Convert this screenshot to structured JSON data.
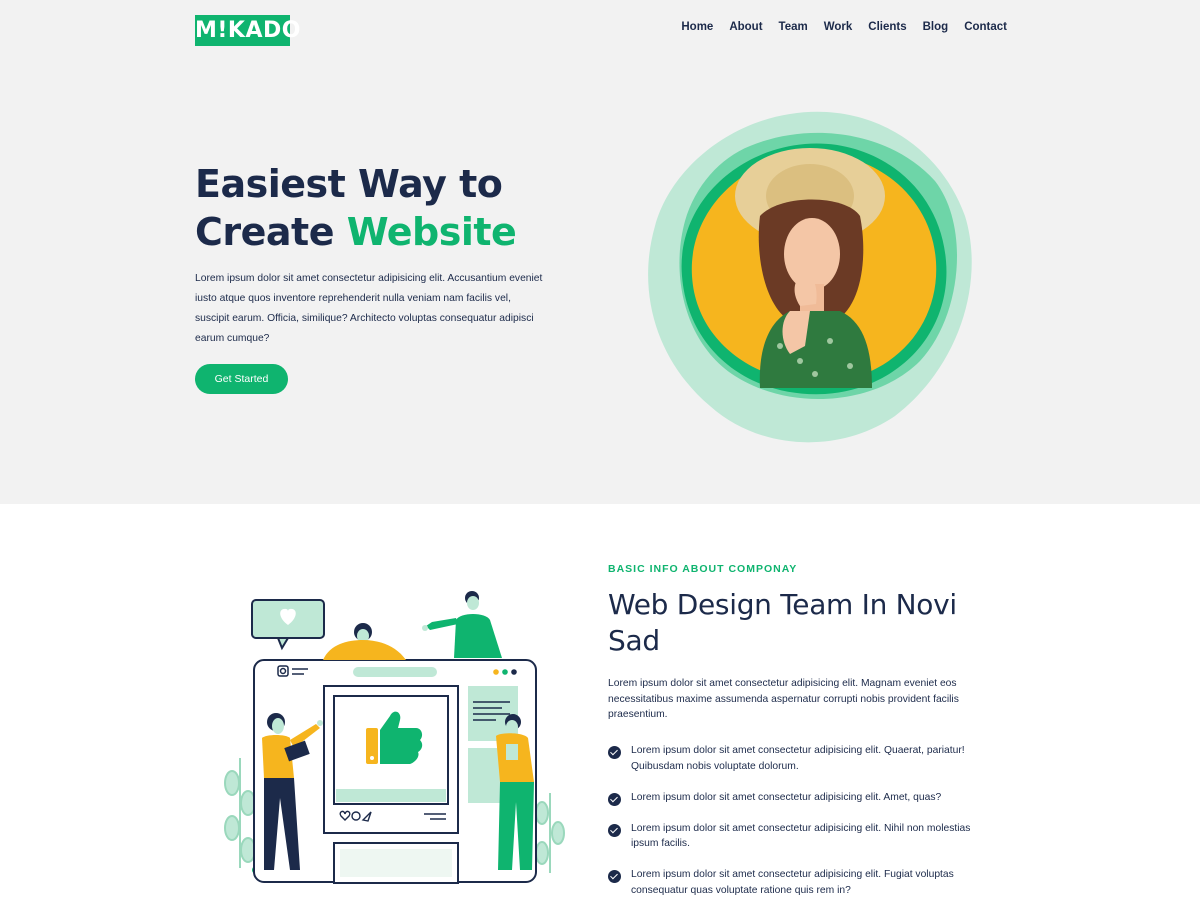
{
  "logo": {
    "text": "M!KADO"
  },
  "nav": {
    "items": [
      "Home",
      "About",
      "Team",
      "Work",
      "Clients",
      "Blog",
      "Contact"
    ]
  },
  "hero": {
    "title_line1": "Easiest Way to",
    "title_line2_plain": "Create",
    "title_line2_accent": "Website",
    "paragraph": "Lorem ipsum dolor sit amet consectetur adipisicing elit. Accusantium eveniet iusto atque quos inventore reprehenderit nulla veniam nam facilis vel, suscipit earum. Officia, similique? Architecto voluptas consequatur adipisci earum cumque?",
    "cta_label": "Get Started"
  },
  "info": {
    "eyebrow": "BASIC INFO ABOUT COMPONAY",
    "title": "Web Design Team In Novi Sad",
    "paragraph": "Lorem ipsum dolor sit amet consectetur adipisicing elit. Magnam eveniet eos necessitatibus maxime assumenda aspernatur corrupti nobis provident facilis praesentium.",
    "checklist": [
      "Lorem ipsum dolor sit amet consectetur adipisicing elit. Quaerat, pariatur! Quibusdam nobis voluptate dolorum.",
      "Lorem ipsum dolor sit amet consectetur adipisicing elit. Amet, quas?",
      "Lorem ipsum dolor sit amet consectetur adipisicing elit. Nihil non molestias ipsum facilis.",
      "Lorem ipsum dolor sit amet consectetur adipisicing elit. Fugiat voluptas consequatur quas voluptate ratione quis rem in?"
    ]
  },
  "colors": {
    "accent": "#0fb46f",
    "navy": "#1c2a4a",
    "hero_bg": "#f2f2f2",
    "yellow": "#f6b51e",
    "mint": "#bfe8d6"
  },
  "icons": [
    "check-circle-icon",
    "heart-icon",
    "thumbs-up-icon",
    "instagram-icon",
    "comment-icon",
    "send-icon"
  ]
}
